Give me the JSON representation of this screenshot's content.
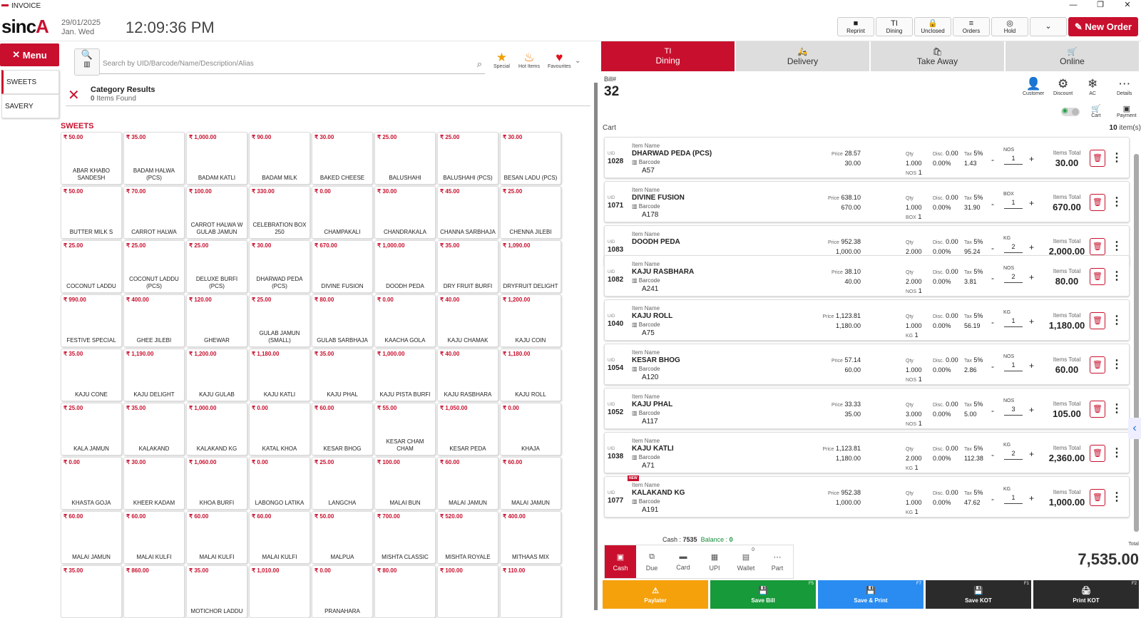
{
  "window": {
    "title": "INVOICE",
    "min": "—",
    "max": "❐",
    "close": "✕"
  },
  "header": {
    "logo_text": "sinc",
    "logo_accent": "A",
    "date": "29/01/2025",
    "day": "Jan. Wed",
    "time": "12:09:36 PM",
    "buttons": [
      {
        "label": "Reprint",
        "icon": "■"
      },
      {
        "label": "Dining",
        "icon": "TI"
      },
      {
        "label": "Unclosed",
        "icon": "🔒"
      },
      {
        "label": "Orders",
        "icon": "≡"
      },
      {
        "label": "Hold",
        "icon": "◎"
      },
      {
        "label": "",
        "icon": "⌄"
      }
    ],
    "new_order": "New Order"
  },
  "sidebar": {
    "menu_label": "Menu",
    "categories": [
      "SWEETS",
      "SAVERY"
    ]
  },
  "search": {
    "placeholder": "Search by UID/Barcode/Name/Description/Alias"
  },
  "quick": {
    "special": "Special",
    "hot": "Hot Items",
    "favourites": "Favourites"
  },
  "category_results": {
    "title": "Category Results",
    "count": "0",
    "items_found": "Items Found"
  },
  "section_title": "SWEETS",
  "products": [
    {
      "p": "₹ 50.00",
      "n": "ABAR KHABO SANDESH"
    },
    {
      "p": "₹ 35.00",
      "n": "BADAM HALWA (PCS)"
    },
    {
      "p": "₹ 1,000.00",
      "n": "BADAM KATLI"
    },
    {
      "p": "₹ 90.00",
      "n": "BADAM MILK"
    },
    {
      "p": "₹ 30.00",
      "n": "BAKED CHEESE"
    },
    {
      "p": "₹ 25.00",
      "n": "BALUSHAHI"
    },
    {
      "p": "₹ 25.00",
      "n": "BALUSHAHI (PCS)"
    },
    {
      "p": "₹ 30.00",
      "n": "BESAN LADU (PCS)"
    },
    {
      "p": "₹ 50.00",
      "n": "BUTTER MILK S"
    },
    {
      "p": "₹ 70.00",
      "n": "CARROT HALWA"
    },
    {
      "p": "₹ 100.00",
      "n": "CARROT HALWA W GULAB JAMUN"
    },
    {
      "p": "₹ 330.00",
      "n": "CELEBRATION BOX 250"
    },
    {
      "p": "₹ 0.00",
      "n": "CHAMPAKALI"
    },
    {
      "p": "₹ 30.00",
      "n": "CHANDRAKALA"
    },
    {
      "p": "₹ 45.00",
      "n": "CHANNA SARBHAJA"
    },
    {
      "p": "₹ 25.00",
      "n": "CHENNA JILEBI"
    },
    {
      "p": "₹ 25.00",
      "n": "COCONUT LADDU"
    },
    {
      "p": "₹ 25.00",
      "n": "COCONUT LADDU (PCS)"
    },
    {
      "p": "₹ 25.00",
      "n": "DELUXE BURFI (PCS)"
    },
    {
      "p": "₹ 30.00",
      "n": "DHARWAD PEDA (PCS)"
    },
    {
      "p": "₹ 670.00",
      "n": "DIVINE FUSION"
    },
    {
      "p": "₹ 1,000.00",
      "n": "DOODH PEDA"
    },
    {
      "p": "₹ 35.00",
      "n": "DRY FRUIT BURFI"
    },
    {
      "p": "₹ 1,090.00",
      "n": "DRYFRUIT DELIGHT"
    },
    {
      "p": "₹ 990.00",
      "n": "FESTIVE SPECIAL"
    },
    {
      "p": "₹ 400.00",
      "n": "GHEE JILEBI"
    },
    {
      "p": "₹ 120.00",
      "n": "GHEWAR"
    },
    {
      "p": "₹ 25.00",
      "n": "GULAB JAMUN (SMALL)"
    },
    {
      "p": "₹ 80.00",
      "n": "GULAB SARBHAJA"
    },
    {
      "p": "₹ 0.00",
      "n": "KAACHA GOLA"
    },
    {
      "p": "₹ 40.00",
      "n": "KAJU CHAMAK"
    },
    {
      "p": "₹ 1,200.00",
      "n": "KAJU COIN"
    },
    {
      "p": "₹ 35.00",
      "n": "KAJU CONE"
    },
    {
      "p": "₹ 1,190.00",
      "n": "KAJU DELIGHT"
    },
    {
      "p": "₹ 1,200.00",
      "n": "KAJU GULAB"
    },
    {
      "p": "₹ 1,180.00",
      "n": "KAJU KATLI"
    },
    {
      "p": "₹ 35.00",
      "n": "KAJU PHAL"
    },
    {
      "p": "₹ 1,000.00",
      "n": "KAJU PISTA BURFI"
    },
    {
      "p": "₹ 40.00",
      "n": "KAJU RASBHARA"
    },
    {
      "p": "₹ 1,180.00",
      "n": "KAJU ROLL"
    },
    {
      "p": "₹ 25.00",
      "n": "KALA JAMUN"
    },
    {
      "p": "₹ 35.00",
      "n": "KALAKAND"
    },
    {
      "p": "₹ 1,000.00",
      "n": "KALAKAND KG"
    },
    {
      "p": "₹ 0.00",
      "n": "KATAL KHOA"
    },
    {
      "p": "₹ 60.00",
      "n": "KESAR BHOG"
    },
    {
      "p": "₹ 55.00",
      "n": "KESAR CHAM CHAM"
    },
    {
      "p": "₹ 1,050.00",
      "n": "KESAR PEDA"
    },
    {
      "p": "₹ 0.00",
      "n": "KHAJA"
    },
    {
      "p": "₹ 0.00",
      "n": "KHASTA GOJA"
    },
    {
      "p": "₹ 30.00",
      "n": "KHEER KADAM"
    },
    {
      "p": "₹ 1,060.00",
      "n": "KHOA BURFI"
    },
    {
      "p": "₹ 0.00",
      "n": "LABONGO LATIKA"
    },
    {
      "p": "₹ 25.00",
      "n": "LANGCHA"
    },
    {
      "p": "₹ 100.00",
      "n": "MALAI BUN"
    },
    {
      "p": "₹ 60.00",
      "n": "MALAI JAMUN"
    },
    {
      "p": "₹ 60.00",
      "n": "MALAI JAMUN"
    },
    {
      "p": "₹ 60.00",
      "n": "MALAI JAMUN"
    },
    {
      "p": "₹ 60.00",
      "n": "MALAI KULFI"
    },
    {
      "p": "₹ 60.00",
      "n": "MALAI KULFI"
    },
    {
      "p": "₹ 60.00",
      "n": "MALAI KULFI"
    },
    {
      "p": "₹ 50.00",
      "n": "MALPUA"
    },
    {
      "p": "₹ 700.00",
      "n": "MISHTA CLASSIC"
    },
    {
      "p": "₹ 520.00",
      "n": "MISHTA ROYALE"
    },
    {
      "p": "₹ 400.00",
      "n": "MITHAAS MIX"
    },
    {
      "p": "₹ 35.00",
      "n": ""
    },
    {
      "p": "₹ 860.00",
      "n": ""
    },
    {
      "p": "₹ 35.00",
      "n": "MOTICHOR LADDU"
    },
    {
      "p": "₹ 1,010.00",
      "n": ""
    },
    {
      "p": "₹ 0.00",
      "n": "PRANAHARA"
    },
    {
      "p": "₹ 80.00",
      "n": ""
    },
    {
      "p": "₹ 100.00",
      "n": ""
    },
    {
      "p": "₹ 110.00",
      "n": ""
    }
  ],
  "order_tabs": [
    {
      "label": "Dining",
      "icon": "TI"
    },
    {
      "label": "Delivery",
      "icon": "🛵"
    },
    {
      "label": "Take Away",
      "icon": "🛍"
    },
    {
      "label": "Online",
      "icon": "🛒"
    }
  ],
  "bill": {
    "label": "Bill#",
    "number": "32"
  },
  "bill_actions": {
    "customer": "Customer",
    "discount": "Discount",
    "ac": "AC",
    "details": "Details",
    "cart": "Cart",
    "payment": "Payment"
  },
  "cart": {
    "label": "Cart",
    "count": "10",
    "count_suffix": "item(s)"
  },
  "cart_labels": {
    "uid": "UID",
    "item_name": "Item Name",
    "barcode": "Barcode",
    "price": "Price",
    "qty": "Qty",
    "disc": "Disc.",
    "tax": "Tax",
    "items_total": "Items Total",
    "new": "NEW"
  },
  "cart_items": [
    {
      "uid": "1028",
      "name": "DHARWAD PEDA (PCS)",
      "barcode": "A57",
      "price": "28.57",
      "price2": "30.00",
      "qty": "1.000",
      "unit": "NOS",
      "unit_qty": "1",
      "disc": "0.00",
      "disc_pct": "0.00%",
      "tax": "5%",
      "tax_amt": "1.43",
      "count": "1",
      "total": "30.00",
      "new": false
    },
    {
      "uid": "1071",
      "name": "DIVINE FUSION",
      "barcode": "A178",
      "price": "638.10",
      "price2": "670.00",
      "qty": "1.000",
      "unit": "BOX",
      "unit_qty": "1",
      "disc": "0.00",
      "disc_pct": "0.00%",
      "tax": "5%",
      "tax_amt": "31.90",
      "count": "1",
      "total": "670.00",
      "new": false
    },
    {
      "uid": "1083",
      "name": "DOODH PEDA",
      "barcode": "",
      "price": "952.38",
      "price2": "1,000.00",
      "qty": "2.000",
      "unit": "KG",
      "unit_qty": "1",
      "disc": "0.00",
      "disc_pct": "0.00%",
      "tax": "5%",
      "tax_amt": "95.24",
      "count": "2",
      "total": "2,000.00",
      "new": false
    },
    {
      "uid": "1082",
      "name": "KAJU RASBHARA",
      "barcode": "A241",
      "price": "38.10",
      "price2": "40.00",
      "qty": "2.000",
      "unit": "NOS",
      "unit_qty": "1",
      "disc": "0.00",
      "disc_pct": "0.00%",
      "tax": "5%",
      "tax_amt": "3.81",
      "count": "2",
      "total": "80.00",
      "new": false
    },
    {
      "uid": "1040",
      "name": "KAJU ROLL",
      "barcode": "A75",
      "price": "1,123.81",
      "price2": "1,180.00",
      "qty": "1.000",
      "unit": "KG",
      "unit_qty": "1",
      "disc": "0.00",
      "disc_pct": "0.00%",
      "tax": "5%",
      "tax_amt": "56.19",
      "count": "1",
      "total": "1,180.00",
      "new": false
    },
    {
      "uid": "1054",
      "name": "KESAR BHOG",
      "barcode": "A120",
      "price": "57.14",
      "price2": "60.00",
      "qty": "1.000",
      "unit": "NOS",
      "unit_qty": "1",
      "disc": "0.00",
      "disc_pct": "0.00%",
      "tax": "5%",
      "tax_amt": "2.86",
      "count": "1",
      "total": "60.00",
      "new": false
    },
    {
      "uid": "1052",
      "name": "KAJU PHAL",
      "barcode": "A117",
      "price": "33.33",
      "price2": "35.00",
      "qty": "3.000",
      "unit": "NOS",
      "unit_qty": "1",
      "disc": "0.00",
      "disc_pct": "0.00%",
      "tax": "5%",
      "tax_amt": "5.00",
      "count": "3",
      "total": "105.00",
      "new": false
    },
    {
      "uid": "1038",
      "name": "KAJU KATLI",
      "barcode": "A71",
      "price": "1,123.81",
      "price2": "1,180.00",
      "qty": "2.000",
      "unit": "KG",
      "unit_qty": "1",
      "disc": "0.00",
      "disc_pct": "0.00%",
      "tax": "5%",
      "tax_amt": "112.38",
      "count": "2",
      "total": "2,360.00",
      "new": false
    },
    {
      "uid": "1077",
      "name": "KALAKAND KG",
      "barcode": "A191",
      "price": "952.38",
      "price2": "1,000.00",
      "qty": "1.000",
      "unit": "KG",
      "unit_qty": "1",
      "disc": "0.00",
      "disc_pct": "0.00%",
      "tax": "5%",
      "tax_amt": "47.62",
      "count": "1",
      "total": "1,000.00",
      "new": true
    }
  ],
  "payment": {
    "cash_label": "Cash :",
    "cash_value": "7535",
    "balance_label": "Balance :",
    "balance_value": "0",
    "methods": [
      {
        "label": "Cash",
        "icon": "▣"
      },
      {
        "label": "Due",
        "icon": "⧉"
      },
      {
        "label": "Card",
        "icon": "▬"
      },
      {
        "label": "UPI",
        "icon": "▦"
      },
      {
        "label": "Wallet",
        "icon": "▤",
        "badge": "0"
      },
      {
        "label": "Part",
        "icon": "⋯"
      }
    ]
  },
  "total": {
    "label": "Total",
    "value": "7,535.00"
  },
  "actions": [
    {
      "label": "Paylater",
      "icon": "⚠",
      "key": "",
      "color": "#f5a10c"
    },
    {
      "label": "Save Bill",
      "icon": "💾",
      "key": "F5",
      "color": "#179a3a"
    },
    {
      "label": "Save & Print",
      "icon": "💾",
      "key": "F7",
      "color": "#2a8cf0"
    },
    {
      "label": "Save KOT",
      "icon": "💾",
      "key": "F1",
      "color": "#2b2b2b"
    },
    {
      "label": "Print KOT",
      "icon": "🖨",
      "key": "F2",
      "color": "#2b2b2b"
    }
  ]
}
